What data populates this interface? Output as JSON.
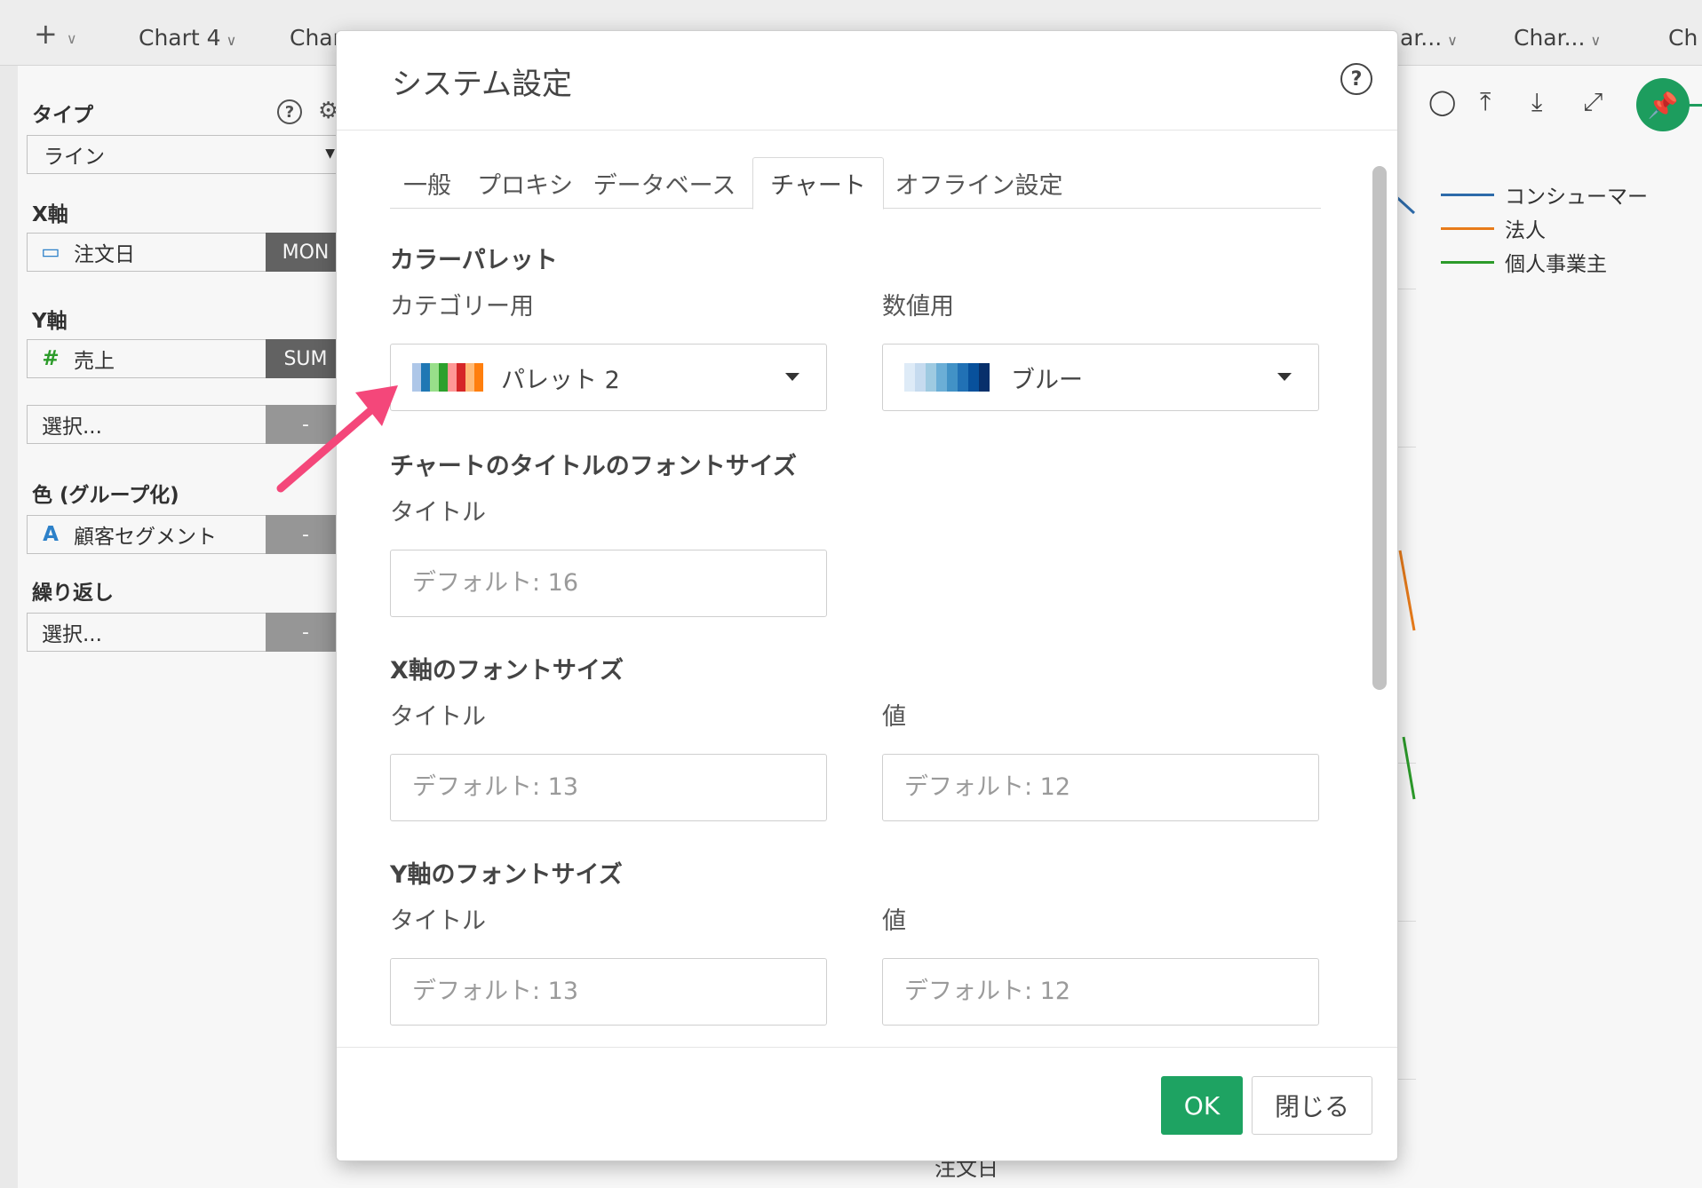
{
  "topbar": {
    "add_symbol": "+",
    "tabs": [
      "Chart 4",
      "Char",
      "ar...",
      "Char...",
      "Ch"
    ]
  },
  "sidebar": {
    "type_label": "タイプ",
    "type_value": "ライン",
    "x_label": "X軸",
    "x_field": "注文日",
    "x_agg": "MON",
    "y_label": "Y軸",
    "y_field": "売上",
    "y_agg": "SUM",
    "y_extra": "選択...",
    "y_extra_agg": "-",
    "color_label": "色 (グループ化)",
    "color_field": "顧客セグメント",
    "color_agg": "-",
    "repeat_label": "繰り返し",
    "repeat_field": "選択...",
    "repeat_agg": "-",
    "icon_hash": "#",
    "icon_a": "A"
  },
  "legend": [
    {
      "name": "コンシューマー",
      "color": "#2f6fb0"
    },
    {
      "name": "法人",
      "color": "#f07f1b"
    },
    {
      "name": "個人事業主",
      "color": "#2ea02c"
    }
  ],
  "background_chart": {
    "x_title": "注文日"
  },
  "modal": {
    "title": "システム設定",
    "help": "?",
    "tabs": [
      "一般",
      "プロキシ",
      "データベース",
      "チャート",
      "オフライン設定"
    ],
    "active_tab": "チャート",
    "palette_section": "カラーパレット",
    "category_label": "カテゴリー用",
    "numeric_label": "数値用",
    "category_value": "パレット 2",
    "numeric_value": "ブルー",
    "category_palette_colors": [
      "#aec7e8",
      "#1f77b4",
      "#98df8a",
      "#2ca02c",
      "#ff9896",
      "#d62728",
      "#ffbb78",
      "#ff7f0e"
    ],
    "numeric_palette_colors": [
      "#deebf7",
      "#c6dbef",
      "#9ecae1",
      "#6baed6",
      "#4292c6",
      "#2171b5",
      "#08519c",
      "#08306b"
    ],
    "chart_title_section": "チャートのタイトルのフォントサイズ",
    "chart_title_label": "タイトル",
    "chart_title_placeholder": "デフォルト: 16",
    "x_section": "X軸のフォントサイズ",
    "x_title_label": "タイトル",
    "x_value_label": "値",
    "x_title_placeholder": "デフォルト: 13",
    "x_value_placeholder": "デフォルト: 12",
    "y_section": "Y軸のフォントサイズ",
    "y_title_label": "タイトル",
    "y_value_label": "値",
    "y_title_placeholder": "デフォルト: 13",
    "y_value_placeholder": "デフォルト: 12",
    "ok_label": "OK",
    "close_label": "閉じる"
  },
  "colors": {
    "accent_green": "#1ea362",
    "annotation_pink": "#f4477a"
  }
}
